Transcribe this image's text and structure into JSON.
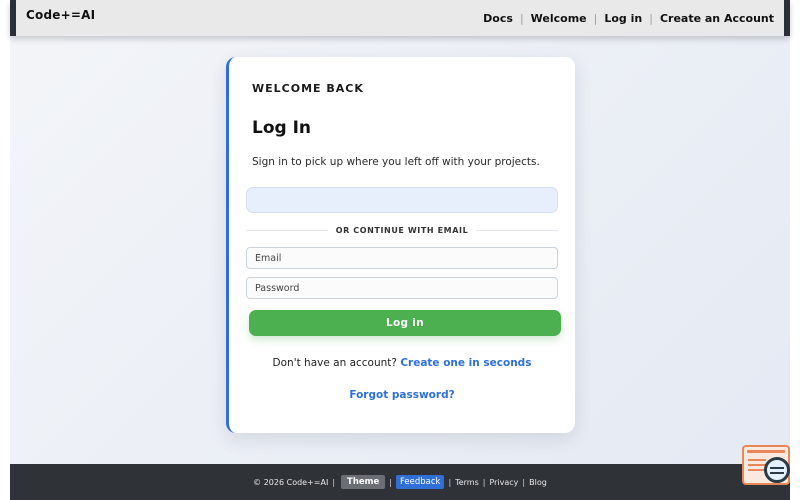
{
  "nav": {
    "brand": "Code+=AI",
    "links": [
      "Docs",
      "Welcome",
      "Log in",
      "Create an Account"
    ]
  },
  "login": {
    "eyebrow": "WELCOME BACK",
    "title": "Log In",
    "subtitle": "Sign in to pick up where you left off with your projects.",
    "divider_text": "OR CONTINUE WITH EMAIL",
    "email_placeholder": "Email",
    "password_placeholder": "Password",
    "submit_label": "Log in",
    "signup_prompt": "Don't have an account?",
    "signup_link": "Create one in seconds",
    "forgot_link": "Forgot password?"
  },
  "footer": {
    "copyright": "© 2026 Code+=AI",
    "theme_label": "Theme",
    "feedback_label": "Feedback",
    "terms": "Terms",
    "privacy": "Privacy",
    "blog": "Blog"
  },
  "colors": {
    "accent": "#2f6fd6",
    "primary_button": "#4caf50",
    "footer_bg": "#2f3338",
    "widget_orange": "#e8875a"
  },
  "icons": {
    "floating_widget": "chat-widget-icon"
  }
}
